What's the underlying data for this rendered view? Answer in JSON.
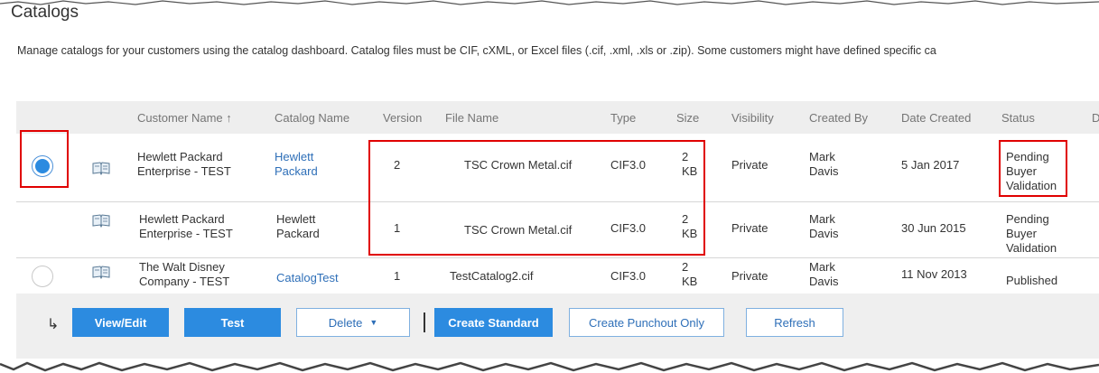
{
  "page": {
    "title": "Catalogs",
    "description": "Manage catalogs for your customers using the catalog dashboard. Catalog files must be CIF, cXML, or Excel files (.cif, .xml, .xls or .zip). Some customers might have defined specific ca"
  },
  "table": {
    "headers": {
      "customer_name": "Customer Name ↑",
      "catalog_name": "Catalog Name",
      "version": "Version",
      "file_name": "File Name",
      "type": "Type",
      "size": "Size",
      "visibility": "Visibility",
      "created_by": "Created By",
      "date_created": "Date Created",
      "status": "Status",
      "extra": "D"
    },
    "rows": [
      {
        "selected": true,
        "icon": "catalog-book-icon",
        "customer_line1": "Hewlett Packard",
        "customer_line2": "Enterprise - TEST",
        "catalog_line1": "Hewlett",
        "catalog_line2": "Packard",
        "version": "2",
        "file_name": "TSC Crown Metal.cif",
        "type": "CIF3.0",
        "size_line1": "2",
        "size_line2": "KB",
        "visibility": "Private",
        "created_line1": "Mark",
        "created_line2": "Davis",
        "date_created": "5 Jan 2017",
        "status_line1": "Pending",
        "status_line2": "Buyer",
        "status_line3": "Validation"
      },
      {
        "selected": false,
        "icon": "catalog-book-icon",
        "customer_line1": "Hewlett Packard",
        "customer_line2": "Enterprise - TEST",
        "catalog_line1": "Hewlett",
        "catalog_line2": "Packard",
        "version": "1",
        "file_name": "TSC Crown Metal.cif",
        "type": "CIF3.0",
        "size_line1": "2",
        "size_line2": "KB",
        "visibility": "Private",
        "created_line1": "Mark",
        "created_line2": "Davis",
        "date_created": "30 Jun 2015",
        "status_line1": "Pending",
        "status_line2": "Buyer",
        "status_line3": "Validation"
      },
      {
        "selected": false,
        "icon": "catalog-book-icon",
        "customer_line1": "The Walt Disney",
        "customer_line2": "Company - TEST",
        "catalog_name": "CatalogTest",
        "version": "1",
        "file_name": "TestCatalog2.cif",
        "type": "CIF3.0",
        "size_line1": "2",
        "size_line2": "KB",
        "visibility": "Private",
        "created_line1": "Mark",
        "created_line2": "Davis",
        "date_created": "11 Nov 2013",
        "status": "Published"
      }
    ]
  },
  "actions": {
    "return_icon": "return-arrow-icon",
    "view_edit": "View/Edit",
    "test": "Test",
    "delete": "Delete",
    "delete_arrow": "▼",
    "create_standard": "Create Standard",
    "create_punchout": "Create Punchout Only",
    "refresh": "Refresh"
  },
  "colors": {
    "primary_button": "#2c8be0",
    "link": "#2e6fb8",
    "highlight_box": "#e00000"
  }
}
